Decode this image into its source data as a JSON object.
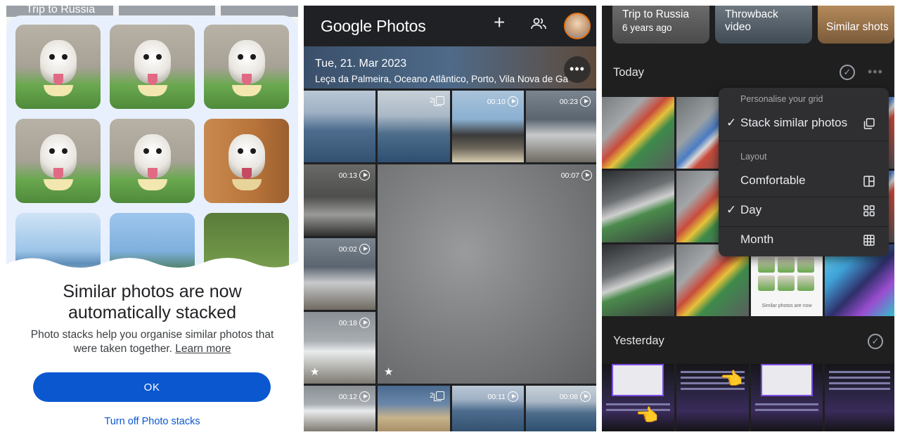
{
  "panel1": {
    "peek_label": "Trip to Russia",
    "title_line1": "Similar photos are now",
    "title_line2": "automatically stacked",
    "body": "Photo stacks help you organise similar photos that were taken together.",
    "learn_more": "Learn more",
    "ok_button": "OK",
    "turn_off": "Turn off Photo stacks"
  },
  "panel2": {
    "logo": "Google Photos",
    "date": "Tue, 21. Mar 2023",
    "location": "Leça da Palmeira, Oceano Atlântico, Porto, Vila Nova de Ga",
    "badges": {
      "stack_a": "2",
      "v1": "00:10",
      "v2": "00:23",
      "v3": "00:13",
      "v4": "00:07",
      "v5": "00:02",
      "v6": "00:18",
      "v7": "00:12",
      "stack_b": "2",
      "v8": "00:11",
      "v9": "00:08"
    }
  },
  "panel3": {
    "chips": [
      {
        "title": "Trip to Russia",
        "subtitle": "6 years ago"
      },
      {
        "title": "Throwback",
        "subtitle": "video"
      },
      {
        "title": "Similar shots",
        "subtitle": ""
      }
    ],
    "today": "Today",
    "yesterday": "Yesterday",
    "menu": {
      "section1": "Personalise your grid",
      "stack_similar": "Stack similar photos",
      "section2": "Layout",
      "comfortable": "Comfortable",
      "day": "Day",
      "month": "Month",
      "check": "✓"
    },
    "tile_caption": "Similar photos are now"
  },
  "colors": {
    "accent_blue": "#0b57d0",
    "card_bg": "#e8f0fe",
    "dark_bg": "#202124",
    "menu_bg": "#2f2f32"
  }
}
